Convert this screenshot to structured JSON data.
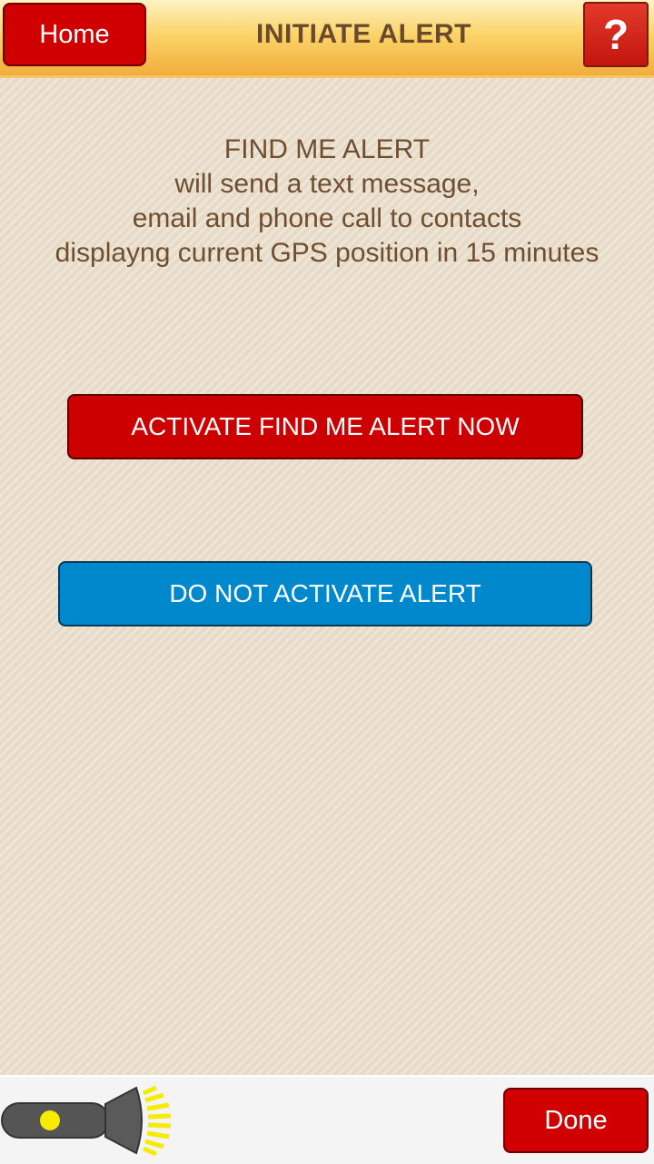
{
  "header": {
    "home_label": "Home",
    "title": "INITIATE ALERT",
    "help_label": "?"
  },
  "message": {
    "lines": [
      "FIND ME ALERT",
      "will send a text message,",
      "email and phone call to contacts",
      "displayng current GPS position in 15 minutes"
    ]
  },
  "actions": {
    "activate_label": "ACTIVATE FIND ME ALERT NOW",
    "cancel_label": "DO NOT ACTIVATE ALERT"
  },
  "footer": {
    "flashlight_icon": "flashlight-icon",
    "done_label": "Done"
  },
  "colors": {
    "red_button": "#cc0000",
    "blue_button": "#0088cc",
    "header_gold": "#f2ad3a",
    "text_brown": "#6f4e31"
  }
}
